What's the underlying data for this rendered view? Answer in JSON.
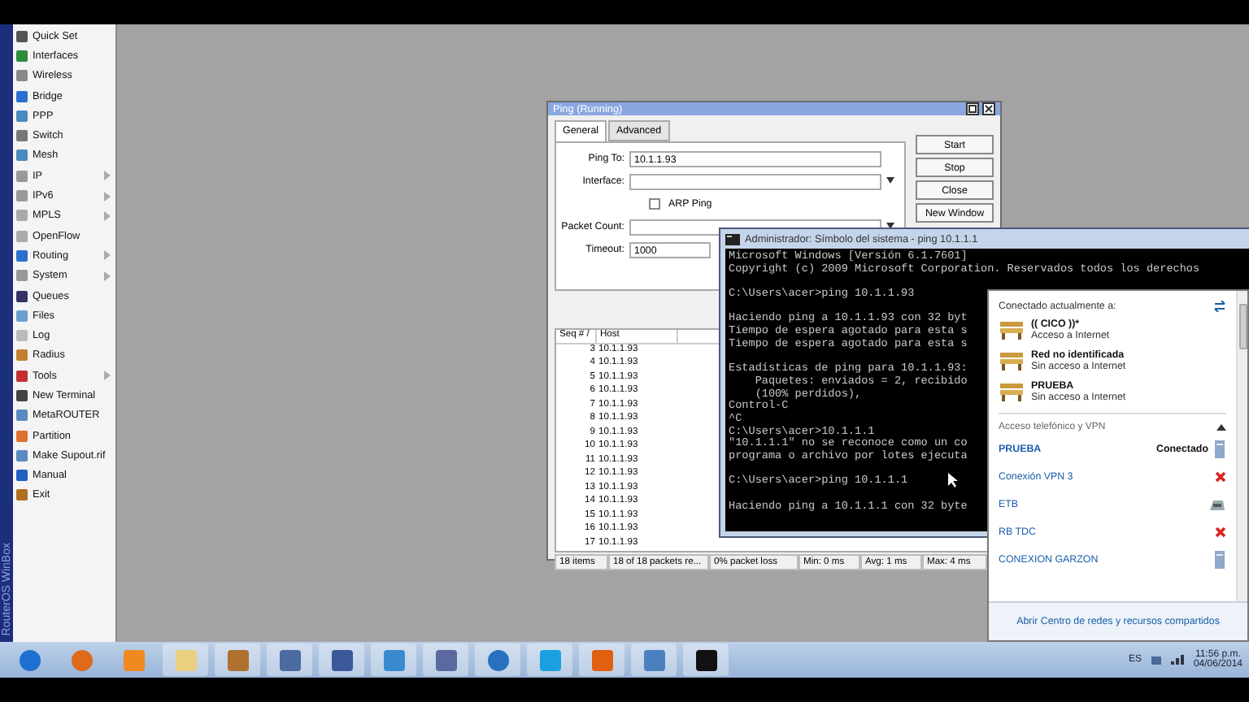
{
  "sidebar": {
    "brand": "RouterOS WinBox",
    "items": [
      {
        "label": "Quick Set",
        "has_submenu": false
      },
      {
        "label": "Interfaces",
        "has_submenu": false
      },
      {
        "label": "Wireless",
        "has_submenu": false
      },
      {
        "label": "Bridge",
        "has_submenu": false
      },
      {
        "label": "PPP",
        "has_submenu": false
      },
      {
        "label": "Switch",
        "has_submenu": false
      },
      {
        "label": "Mesh",
        "has_submenu": false
      },
      {
        "label": "IP",
        "has_submenu": true
      },
      {
        "label": "IPv6",
        "has_submenu": true
      },
      {
        "label": "MPLS",
        "has_submenu": true
      },
      {
        "label": "OpenFlow",
        "has_submenu": false
      },
      {
        "label": "Routing",
        "has_submenu": true
      },
      {
        "label": "System",
        "has_submenu": true
      },
      {
        "label": "Queues",
        "has_submenu": false
      },
      {
        "label": "Files",
        "has_submenu": false
      },
      {
        "label": "Log",
        "has_submenu": false
      },
      {
        "label": "Radius",
        "has_submenu": false
      },
      {
        "label": "Tools",
        "has_submenu": true
      },
      {
        "label": "New Terminal",
        "has_submenu": false
      },
      {
        "label": "MetaROUTER",
        "has_submenu": false
      },
      {
        "label": "Partition",
        "has_submenu": false
      },
      {
        "label": "Make Supout.rif",
        "has_submenu": false
      },
      {
        "label": "Manual",
        "has_submenu": false
      },
      {
        "label": "Exit",
        "has_submenu": false
      }
    ]
  },
  "ping_window": {
    "title": "Ping (Running)",
    "tabs": [
      {
        "label": "General",
        "selected": true
      },
      {
        "label": "Advanced",
        "selected": false
      }
    ],
    "fields": [
      {
        "kind": "text",
        "label": "Ping To:",
        "value": "10.1.1.93"
      },
      {
        "kind": "dropdown",
        "label": "Interface:"
      },
      {
        "kind": "checkbox",
        "label": "ARP Ping",
        "checked": false
      },
      {
        "kind": "dropdown",
        "label": "Packet Count:"
      },
      {
        "kind": "text",
        "label": "Timeout:",
        "value": "1000"
      }
    ],
    "buttons": [
      "Start",
      "Stop",
      "Close",
      "New Window"
    ],
    "table": {
      "columns": [
        "Seq # /",
        "Host"
      ],
      "rows": [
        [
          "3",
          "10.1.1.93"
        ],
        [
          "4",
          "10.1.1.93"
        ],
        [
          "5",
          "10.1.1.93"
        ],
        [
          "6",
          "10.1.1.93"
        ],
        [
          "7",
          "10.1.1.93"
        ],
        [
          "8",
          "10.1.1.93"
        ],
        [
          "9",
          "10.1.1.93"
        ],
        [
          "10",
          "10.1.1.93"
        ],
        [
          "11",
          "10.1.1.93"
        ],
        [
          "12",
          "10.1.1.93"
        ],
        [
          "13",
          "10.1.1.93"
        ],
        [
          "14",
          "10.1.1.93"
        ],
        [
          "15",
          "10.1.1.93"
        ],
        [
          "16",
          "10.1.1.93"
        ],
        [
          "17",
          "10.1.1.93"
        ]
      ]
    },
    "status_bar": [
      "18 items",
      "18 of 18 packets re...",
      "0% packet loss",
      "Min: 0 ms",
      "Avg: 1 ms",
      "Max: 4 ms"
    ]
  },
  "cmd_window": {
    "title": "Administrador: Símbolo del sistema - ping 10.1.1.1",
    "lines": [
      {
        "text": "Microsoft Windows [Versión 6.1.7601]",
        "blank_before": false
      },
      {
        "text": "Copyright (c) 2009 Microsoft Corporation. Reservados todos los derechos",
        "blank_before": false
      },
      {
        "text": "C:\\Users\\acer>ping 10.1.1.93",
        "blank_before": true
      },
      {
        "text": "Haciendo ping a 10.1.1.93 con 32 byt",
        "blank_before": true
      },
      {
        "text": "Tiempo de espera agotado para esta s",
        "blank_before": false
      },
      {
        "text": "Tiempo de espera agotado para esta s",
        "blank_before": false
      },
      {
        "text": "Estadísticas de ping para 10.1.1.93:",
        "blank_before": true
      },
      {
        "text": "    Paquetes: enviados = 2, recibido",
        "blank_before": false
      },
      {
        "text": "    (100% perdidos),",
        "blank_before": false
      },
      {
        "text": "Control-C",
        "blank_before": false
      },
      {
        "text": "^C",
        "blank_before": false
      },
      {
        "text": "C:\\Users\\acer>10.1.1.1",
        "blank_before": false
      },
      {
        "text": "\"10.1.1.1\" no se reconoce como un co",
        "blank_before": false
      },
      {
        "text": "programa o archivo por lotes ejecuta",
        "blank_before": false
      },
      {
        "text": "C:\\Users\\acer>ping 10.1.1.1",
        "blank_before": true
      },
      {
        "text": "Haciendo ping a 10.1.1.1 con 32 byte",
        "blank_before": true
      }
    ]
  },
  "network_popup": {
    "header": "Conectado actualmente a:",
    "networks": [
      {
        "name": "(( CICO ))*",
        "status": "Acceso a Internet"
      },
      {
        "name": "Red no identificada",
        "status": "Sin acceso a Internet"
      },
      {
        "name": "PRUEBA",
        "status": "Sin acceso a Internet"
      }
    ],
    "vpn_section": {
      "title": "Acceso telefónico y VPN",
      "expanded": true,
      "items": [
        {
          "name": "PRUEBA",
          "kind": "server",
          "connected": true,
          "status": "Conectado"
        },
        {
          "name": "Conexión VPN 3",
          "kind": "error",
          "connected": false
        },
        {
          "name": "ETB",
          "kind": "modem",
          "connected": false
        },
        {
          "name": "RB TDC",
          "kind": "error",
          "connected": false
        },
        {
          "name": "CONEXION GARZON",
          "kind": "server",
          "connected": false
        }
      ]
    },
    "footer_link": "Abrir Centro de redes y recursos compartidos"
  },
  "taskbar": {
    "language": "ES",
    "time": "11:56 p.m.",
    "date": "04/06/2014"
  }
}
